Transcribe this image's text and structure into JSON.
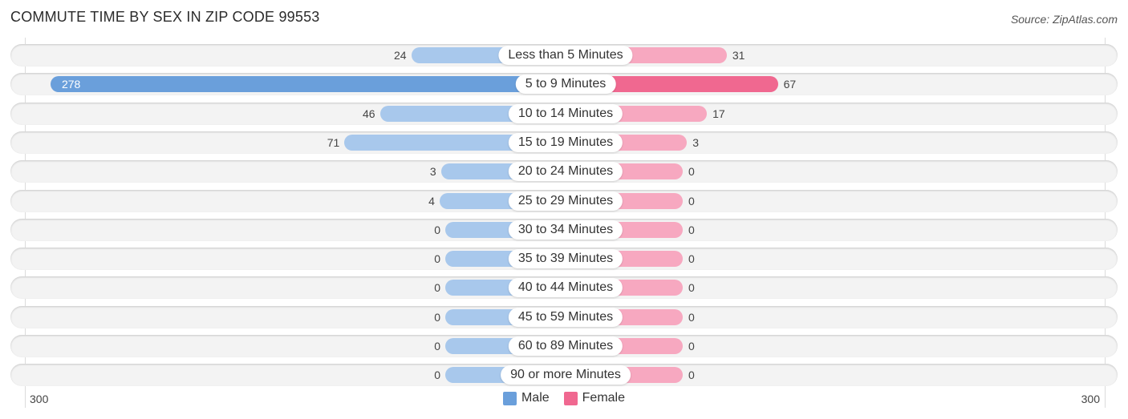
{
  "chart_data": {
    "type": "bar",
    "orientation": "horizontal-diverging",
    "title": "COMMUTE TIME BY SEX IN ZIP CODE 99553",
    "source": "Source: ZipAtlas.com",
    "categories": [
      "Less than 5 Minutes",
      "5 to 9 Minutes",
      "10 to 14 Minutes",
      "15 to 19 Minutes",
      "20 to 24 Minutes",
      "25 to 29 Minutes",
      "30 to 34 Minutes",
      "35 to 39 Minutes",
      "40 to 44 Minutes",
      "45 to 59 Minutes",
      "60 to 89 Minutes",
      "90 or more Minutes"
    ],
    "series": [
      {
        "name": "Male",
        "color": "#6a9fdb",
        "light_color": "#a8c8ec",
        "values": [
          24,
          278,
          46,
          71,
          3,
          4,
          0,
          0,
          0,
          0,
          0,
          0
        ]
      },
      {
        "name": "Female",
        "color": "#f06890",
        "light_color": "#f7a8c0",
        "values": [
          31,
          67,
          17,
          3,
          0,
          0,
          0,
          0,
          0,
          0,
          0,
          0
        ]
      }
    ],
    "axis": {
      "left_label": "300",
      "right_label": "300",
      "xlim": [
        -300,
        300
      ]
    },
    "legend": {
      "position": "bottom-center",
      "items": [
        {
          "label": "Male",
          "color": "#6a9fdb"
        },
        {
          "label": "Female",
          "color": "#f06890"
        }
      ]
    },
    "grid": false
  }
}
